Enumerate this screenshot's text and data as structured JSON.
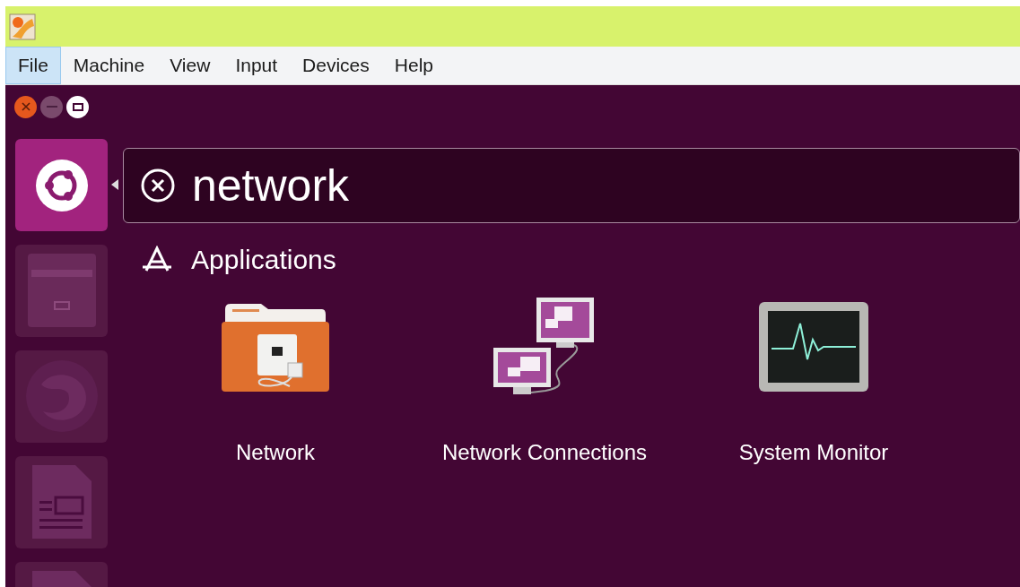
{
  "menu_bar": [
    {
      "label": "File",
      "selected": true
    },
    {
      "label": "Machine",
      "selected": false
    },
    {
      "label": "View",
      "selected": false
    },
    {
      "label": "Input",
      "selected": false
    },
    {
      "label": "Devices",
      "selected": false
    },
    {
      "label": "Help",
      "selected": false
    }
  ],
  "launcher": [
    {
      "kind": "dash",
      "selected": true
    },
    {
      "kind": "files",
      "selected": false
    },
    {
      "kind": "browser",
      "selected": false
    },
    {
      "kind": "document",
      "selected": false
    },
    {
      "kind": "presentation",
      "selected": false
    }
  ],
  "search": {
    "value": "network"
  },
  "section": {
    "title": "Applications"
  },
  "apps": [
    {
      "kind": "network-folder",
      "name": "Network"
    },
    {
      "kind": "connections",
      "name": "Network Connections"
    },
    {
      "kind": "monitor",
      "name": "System Monitor"
    }
  ]
}
